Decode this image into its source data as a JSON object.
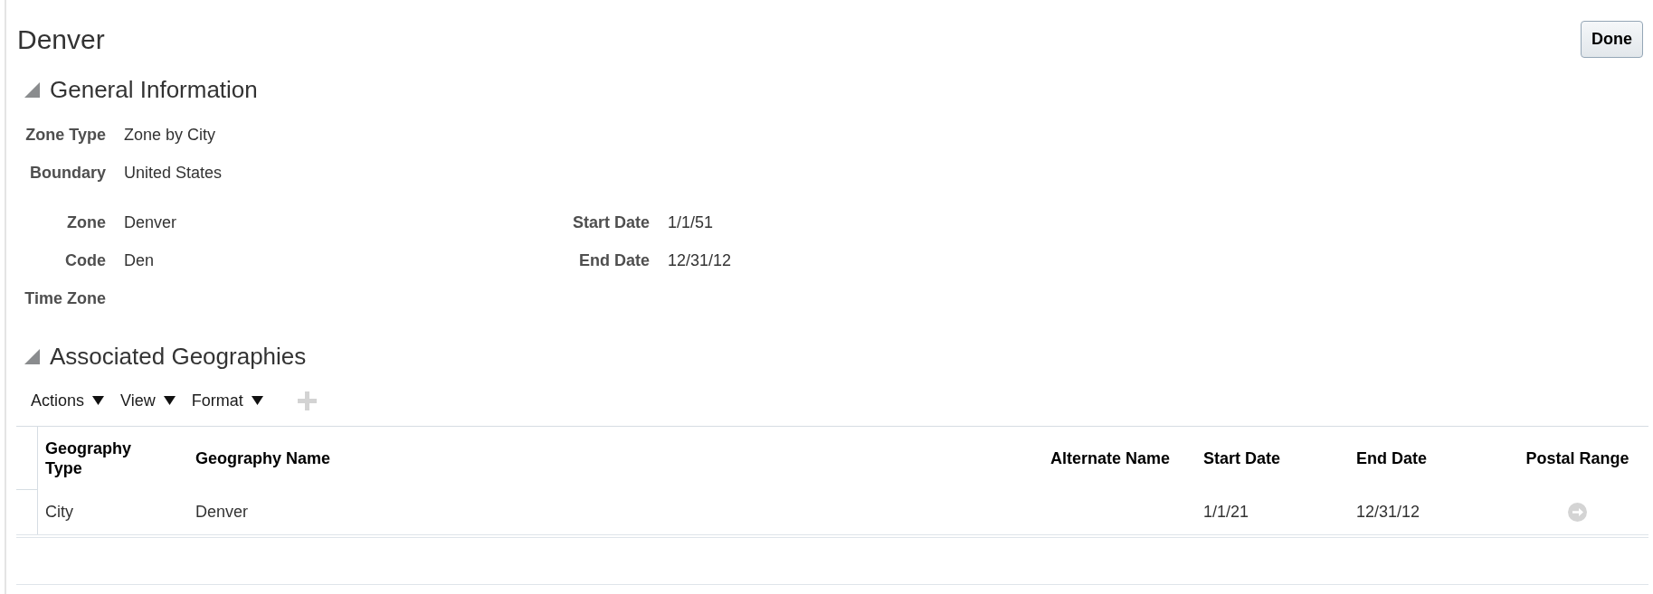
{
  "title": "Denver",
  "done_button": {
    "label": "Done"
  },
  "general_information": {
    "title": "General Information",
    "expanded": true,
    "fields": [
      {
        "label": "Zone Type",
        "value": "Zone by City"
      },
      {
        "label": "Boundary",
        "value": "United States"
      }
    ],
    "columns": [
      [
        {
          "label": "Zone",
          "value": "Denver"
        },
        {
          "label": "Code",
          "value": "Den"
        },
        {
          "label": "Time Zone"
        }
      ],
      [
        {
          "label": "Start Date",
          "value": "1/1/51"
        },
        {
          "label": "End Date",
          "value": "12/31/12"
        }
      ]
    ]
  },
  "associated_geographies": {
    "title": "Associated Geographies",
    "expanded": true,
    "toolbar": {
      "menus": [
        {
          "label": "Actions"
        },
        {
          "label": "View"
        },
        {
          "label": "Format"
        }
      ],
      "add_button": {
        "disabled": true
      }
    },
    "table": {
      "columns": [
        "Geography Type",
        "Geography Name",
        "Alternate Name",
        "Start Date",
        "End Date",
        "Postal Range"
      ],
      "rows": [
        {
          "geography_type": "City",
          "geography_name": "Denver",
          "start_date": "1/1/21",
          "end_date": "12/31/12",
          "postal_range": {
            "disabled": true
          }
        }
      ]
    }
  }
}
